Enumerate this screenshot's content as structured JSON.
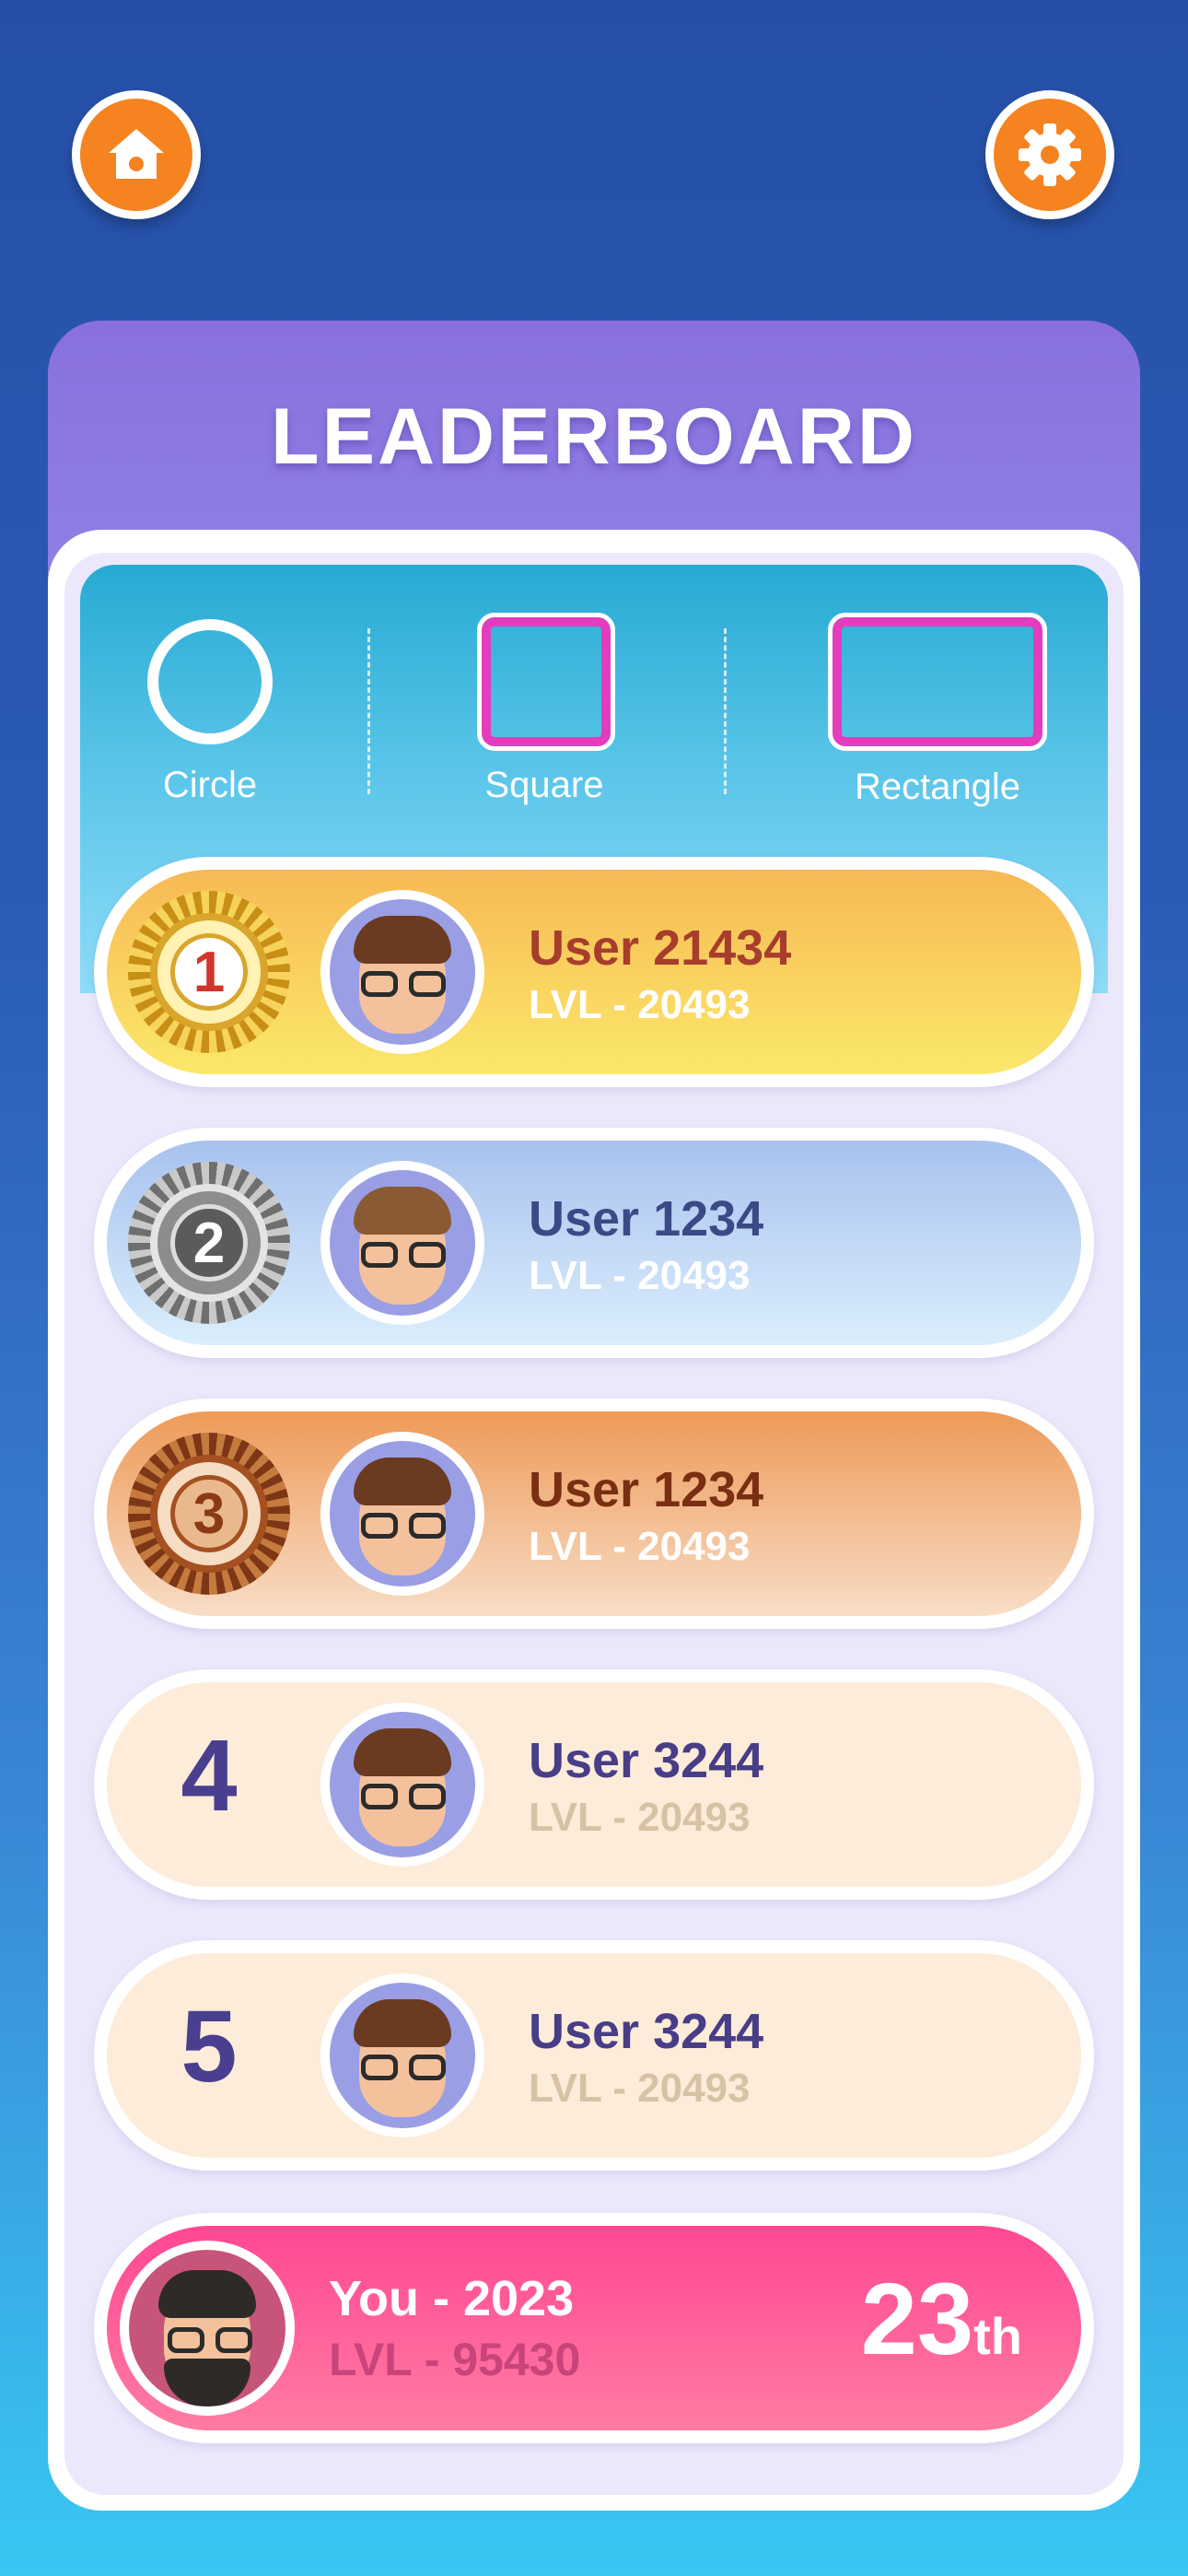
{
  "nav": {
    "home_icon": "home-icon",
    "settings_icon": "gear-icon"
  },
  "title": "LEADERBOARD",
  "tabs": [
    {
      "label": "Circle",
      "icon": "circle-shape-icon"
    },
    {
      "label": "Square",
      "icon": "square-shape-icon"
    },
    {
      "label": "Rectangle",
      "icon": "rectangle-shape-icon"
    }
  ],
  "players": [
    {
      "rank": "1",
      "name": "User 21434",
      "level": "LVL - 20493",
      "badge": "gold-medal"
    },
    {
      "rank": "2",
      "name": "User 1234",
      "level": "LVL - 20493",
      "badge": "silver-medal"
    },
    {
      "rank": "3",
      "name": "User 1234",
      "level": "LVL - 20493",
      "badge": "bronze-medal"
    },
    {
      "rank": "4",
      "name": "User 3244",
      "level": "LVL - 20493"
    },
    {
      "rank": "5",
      "name": "User 3244",
      "level": "LVL - 20493"
    }
  ],
  "you": {
    "name": "You - 2023",
    "level": "LVL - 95430",
    "place": "23",
    "place_suffix": "th"
  },
  "colors": {
    "accent_orange": "#f58320",
    "panel_purple": "#8a70dd",
    "tab_blue": "#27aad3",
    "shape_magenta": "#e23cbf",
    "you_pink": "#ff4893"
  }
}
